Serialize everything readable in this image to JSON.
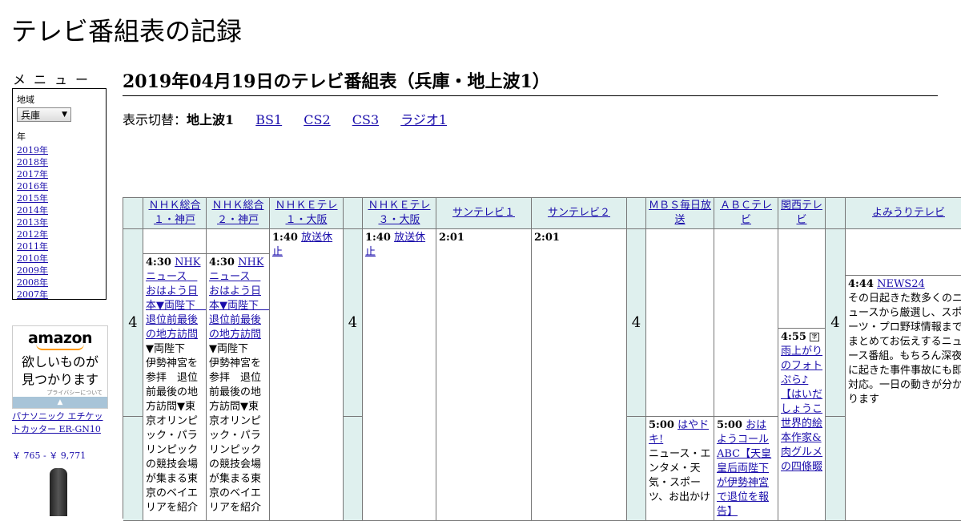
{
  "site": {
    "title": "テレビ番組表の記録"
  },
  "menu": {
    "heading": "メニュー",
    "region_label": "地域",
    "region_value": "兵庫",
    "year_label": "年",
    "years": [
      "2019年",
      "2018年",
      "2017年",
      "2016年",
      "2015年",
      "2014年",
      "2013年",
      "2012年",
      "2011年",
      "2010年",
      "2009年",
      "2008年",
      "2007年"
    ]
  },
  "ad": {
    "logo": "amazon",
    "text_line1": "欲しいものが",
    "text_line2": "見つかります",
    "privacy": "プライバシーについて",
    "product_name": "パナソニック エチケットカッター ER-GN10",
    "product_price": "￥ 765 - ￥ 9,771"
  },
  "page": {
    "title": "2019年04月19日のテレビ番組表（兵庫・地上波1）",
    "switch_label": "表示切替：",
    "switch_current": "地上波1",
    "switch_links": [
      "BS1",
      "CS2",
      "CS3",
      "ラジオ1"
    ]
  },
  "hour": "4",
  "channels": [
    "ＮＨＫ総合１・神戸",
    "ＮＨＫ総合２・神戸",
    "ＮＨＫＥテレ１・大阪",
    "ＮＨＫＥテレ３・大阪",
    "サンテレビ１",
    "サンテレビ２",
    "ＭＢＳ毎日放送",
    "ＡＢＣテレビ",
    "関西テレビ",
    "よみうりテレビ"
  ],
  "programs": {
    "nhk1": {
      "time": "4:30",
      "title": "NHKニュース　おはよう日本▼両陛下　退位前最後の地方訪問",
      "desc": "▼両陛下　伊勢神宮を参拝　退位前最後の地方訪問▼東京オリンピック・パラリンピックの競技会場が集まる東京のベイエリアを紹介"
    },
    "nhk2": {
      "time": "4:30",
      "title": "NHKニュース　おはよう日本▼両陛下　退位前最後の地方訪問",
      "desc": "▼両陛下　伊勢神宮を参拝　退位前最後の地方訪問▼東京オリンピック・パラリンピックの競技会場が集まる東京のベイエリアを紹介"
    },
    "etv1": {
      "time": "1:40",
      "title": "放送休止"
    },
    "etv3": {
      "time": "1:40",
      "title": "放送休止"
    },
    "sun1": {
      "time": "2:01"
    },
    "sun2": {
      "time": "2:01"
    },
    "mbs": {
      "time": "5:00",
      "title": "はやドキ!",
      "desc": "ニュース・エンタメ・天気・スポーツ、お出かけ"
    },
    "abc": {
      "time": "5:00",
      "title": "おはようコールABC【天皇皇后両陛下が伊勢神宮で退位を報告】"
    },
    "ktv": {
      "time": "4:55",
      "title": "雨上がりのフォトぷら♪【はいだしょうこ世界的絵本作家&肉グルメの四條畷"
    },
    "ytv": {
      "time": "4:44",
      "title": "NEWS24",
      "desc": "その日起きた数多くのニュースから厳選し、スポーツ・プロ野球情報までまとめてお伝えするニュース番組。もちろん深夜に起きた事件事故にも即対応。一日の動きが分かります"
    }
  }
}
